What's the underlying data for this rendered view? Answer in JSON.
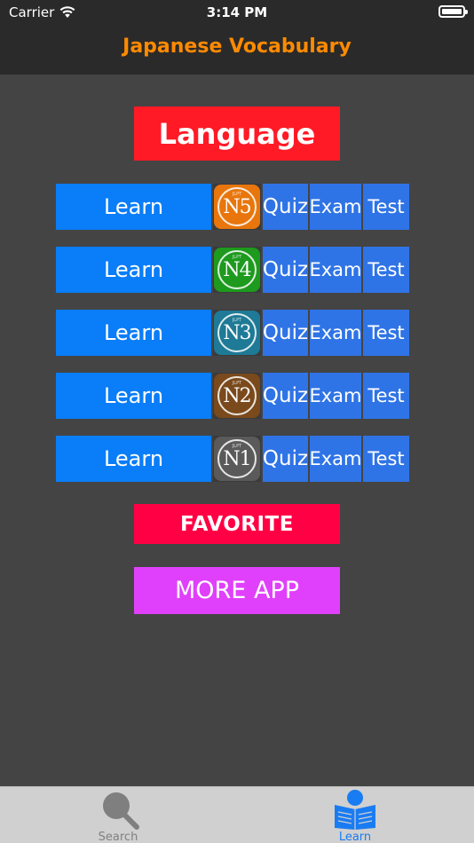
{
  "status_bar": {
    "carrier": "Carrier",
    "time": "3:14 PM"
  },
  "nav": {
    "title": "Japanese Vocabulary"
  },
  "language_button": "Language",
  "levels": [
    {
      "badge": "N5",
      "badge_sub": "JLPT",
      "color": "#e8760c",
      "learn": "Learn",
      "quiz": "Quiz",
      "exam": "Exam",
      "test": "Test"
    },
    {
      "badge": "N4",
      "badge_sub": "JLPT",
      "color": "#1e9a1e",
      "learn": "Learn",
      "quiz": "Quiz",
      "exam": "Exam",
      "test": "Test"
    },
    {
      "badge": "N3",
      "badge_sub": "JLPT",
      "color": "#1e7a96",
      "learn": "Learn",
      "quiz": "Quiz",
      "exam": "Exam",
      "test": "Test"
    },
    {
      "badge": "N2",
      "badge_sub": "JLPT",
      "color": "#7a4a1c",
      "learn": "Learn",
      "quiz": "Quiz",
      "exam": "Exam",
      "test": "Test"
    },
    {
      "badge": "N1",
      "badge_sub": "JLPT",
      "color": "#5a5a5a",
      "learn": "Learn",
      "quiz": "Quiz",
      "exam": "Exam",
      "test": "Test"
    }
  ],
  "favorite_button": "FAVORITE",
  "more_app_button": "MORE APP",
  "tabs": [
    {
      "label": "Search",
      "icon": "magnifier-icon",
      "active": false
    },
    {
      "label": "Learn",
      "icon": "reader-icon",
      "active": true
    }
  ],
  "colors": {
    "nav_title": "#ff8a00",
    "learn_button": "#0a7df8",
    "action_button": "#2f74e6",
    "language_button": "#ff1a26",
    "favorite_button": "#ff0044",
    "more_app_button": "#e040fb",
    "tab_active": "#1a7cf2"
  }
}
